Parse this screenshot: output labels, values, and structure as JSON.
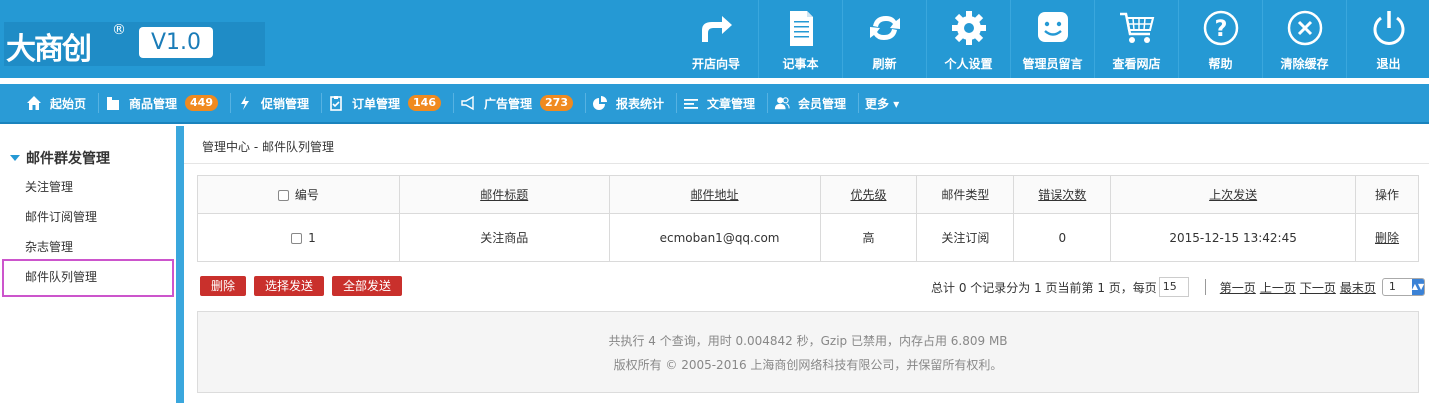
{
  "logo": {
    "brand": "大商创",
    "reg": "®",
    "version": "V1.0"
  },
  "topnav": [
    {
      "icon": "share-arrow-icon",
      "label": "开店向导"
    },
    {
      "icon": "notepad-icon",
      "label": "记事本"
    },
    {
      "icon": "refresh-icon",
      "label": "刷新"
    },
    {
      "icon": "gear-icon",
      "label": "个人设置"
    },
    {
      "icon": "chat-face-icon",
      "label": "管理员留言"
    },
    {
      "icon": "cart-icon",
      "label": "查看网店"
    },
    {
      "icon": "help-icon",
      "label": "帮助"
    },
    {
      "icon": "close-circle-icon",
      "label": "清除缓存"
    },
    {
      "icon": "power-icon",
      "label": "退出"
    }
  ],
  "menubar": [
    {
      "icon": "home-icon",
      "label": "起始页"
    },
    {
      "icon": "folder-icon",
      "label": "商品管理",
      "badge": "449"
    },
    {
      "icon": "lightning-icon",
      "label": "促销管理"
    },
    {
      "icon": "clipboard-icon",
      "label": "订单管理",
      "badge": "146"
    },
    {
      "icon": "megaphone-icon",
      "label": "广告管理",
      "badge": "273"
    },
    {
      "icon": "pie-chart-icon",
      "label": "报表统计"
    },
    {
      "icon": "lines-icon",
      "label": "文章管理"
    },
    {
      "icon": "users-icon",
      "label": "会员管理"
    },
    {
      "icon": "",
      "label": "更多 ▾"
    }
  ],
  "sidebar": {
    "title": "邮件群发管理",
    "items": [
      "关注管理",
      "邮件订阅管理",
      "杂志管理",
      "邮件队列管理"
    ]
  },
  "breadcrumb": {
    "root": "管理中心",
    "sep": " - ",
    "current": "邮件队列管理"
  },
  "table": {
    "headers": [
      "编号",
      "邮件标题",
      "邮件地址",
      "优先级",
      "邮件类型",
      "错误次数",
      "上次发送",
      "操作"
    ],
    "rows": [
      {
        "id": "1",
        "title": "关注商品",
        "email": "ecmoban1@qq.com",
        "priority": "高",
        "type": "关注订阅",
        "errors": "0",
        "last_sent": "2015-12-15 13:42:45",
        "action": "删除"
      }
    ]
  },
  "buttons": {
    "delete": "删除",
    "send_selected": "选择发送",
    "send_all": "全部发送"
  },
  "pager": {
    "summary": "总计 0 个记录分为 1 页当前第 1 页，每页",
    "per_page": "15",
    "first": "第一页",
    "prev": "上一页",
    "next": "下一页",
    "last": "最末页",
    "page_select": "1"
  },
  "footer": {
    "line1": "共执行 4 个查询，用时 0.004842 秒，Gzip 已禁用，内存占用 6.809 MB",
    "line2": "版权所有 © 2005-2016 上海商创网络科技有限公司，并保留所有权利。"
  },
  "colors": {
    "header": "#2599d4",
    "badge": "#f08a1f",
    "danger": "#c9302c",
    "active_outline": "#cc55cc"
  }
}
